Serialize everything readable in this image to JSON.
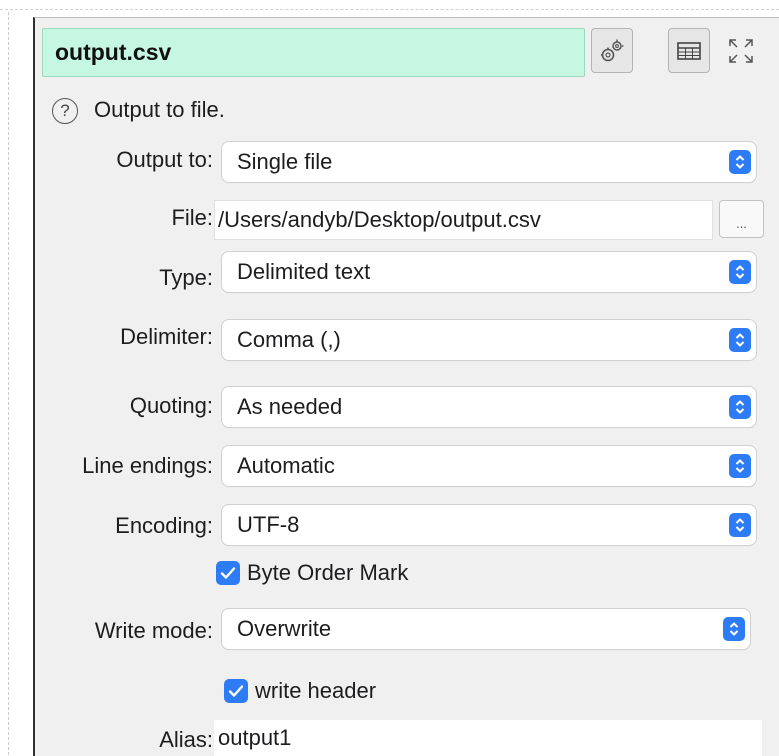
{
  "panel": {
    "title": "output.csv",
    "header_icons": [
      "settings-gears-icon",
      "table-grid-icon",
      "expand-icon"
    ]
  },
  "description": {
    "help_symbol": "?",
    "text": "Output to file."
  },
  "form": {
    "output_to": {
      "label": "Output to:",
      "value": "Single file"
    },
    "file": {
      "label": "File:",
      "value": "/Users/andyb/Desktop/output.csv",
      "browse_label": "..."
    },
    "type": {
      "label": "Type:",
      "value": "Delimited text"
    },
    "delimiter": {
      "label": "Delimiter:",
      "value": "Comma (,)"
    },
    "quoting": {
      "label": "Quoting:",
      "value": "As needed"
    },
    "line_endings": {
      "label": "Line endings:",
      "value": "Automatic"
    },
    "encoding": {
      "label": "Encoding:",
      "value": "UTF-8"
    },
    "byte_order_mark": {
      "label": "Byte Order Mark",
      "checked": true
    },
    "write_mode": {
      "label": "Write mode:",
      "value": "Overwrite"
    },
    "write_header": {
      "label": "write header",
      "checked": true
    },
    "alias": {
      "label": "Alias:",
      "value": "output1"
    }
  },
  "colors": {
    "title_bg": "#c6f7e3",
    "accent": "#2d7cf6",
    "panel_bg": "#f0f0f0"
  }
}
